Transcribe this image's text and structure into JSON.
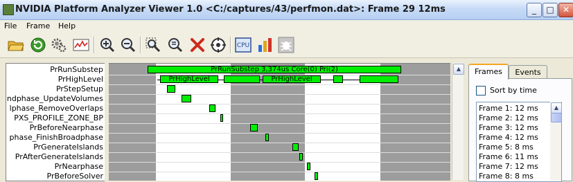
{
  "window": {
    "title": "NVIDIA Platform Analyzer Viewer 1.0 <C:/captures/43/perfmon.dat>: Frame 29 12ms",
    "minimize": "_",
    "maximize": "□",
    "close": "✕"
  },
  "menu": {
    "file": "File",
    "frame": "Frame",
    "help": "Help"
  },
  "toolbar": {
    "icons": [
      "open-folder-icon",
      "refresh-icon",
      "settings-gears-icon",
      "graph-view-icon",
      "zoom-in-icon",
      "zoom-out-icon",
      "zoom-fit-icon",
      "zoom-selection-icon",
      "delete-icon",
      "target-icon",
      "cpu-icon",
      "bar-chart-icon",
      "debug-bug-icon"
    ],
    "cpu_label": "CPU"
  },
  "timeline": {
    "rows": [
      "PrRunSubstep",
      "PrHighLevel",
      "PrStepSetup",
      "ndphase_UpdateVolumes",
      "lphase_RemoveOverlaps",
      "PXS_PROFILE_ZONE_BP",
      "PrBeforeNearphase",
      "phase_FinishBroadphase",
      "PrGenerateIslands",
      "PrAfterGenerateIslands",
      "PrNearphase",
      "PrBeforeSolver"
    ],
    "bar_labels": {
      "run_substep": "PrRunSubstep 3,374us Core(0) Pri(2)",
      "high_level_1": "PrHighLevel",
      "high_level_2": "PrHighLevel"
    }
  },
  "scroll": {
    "up_arrow": "▲",
    "down_arrow": "▼"
  },
  "panel": {
    "tabs": [
      "Frames",
      "Events"
    ],
    "active_tab": "Frames",
    "sort_by_time_label": "Sort by time",
    "sort_by_time_checked": false,
    "frames": [
      "Frame 1: 12 ms",
      "Frame 2: 12 ms",
      "Frame 3: 12 ms",
      "Frame 4: 12 ms",
      "Frame 5: 8 ms",
      "Frame 6: 11 ms",
      "Frame 7: 12 ms",
      "Frame 8: 8 ms"
    ]
  },
  "colors": {
    "bar": "#00ee00",
    "band": "#9d9d9d",
    "active_tab_accent": "#f5a623"
  }
}
